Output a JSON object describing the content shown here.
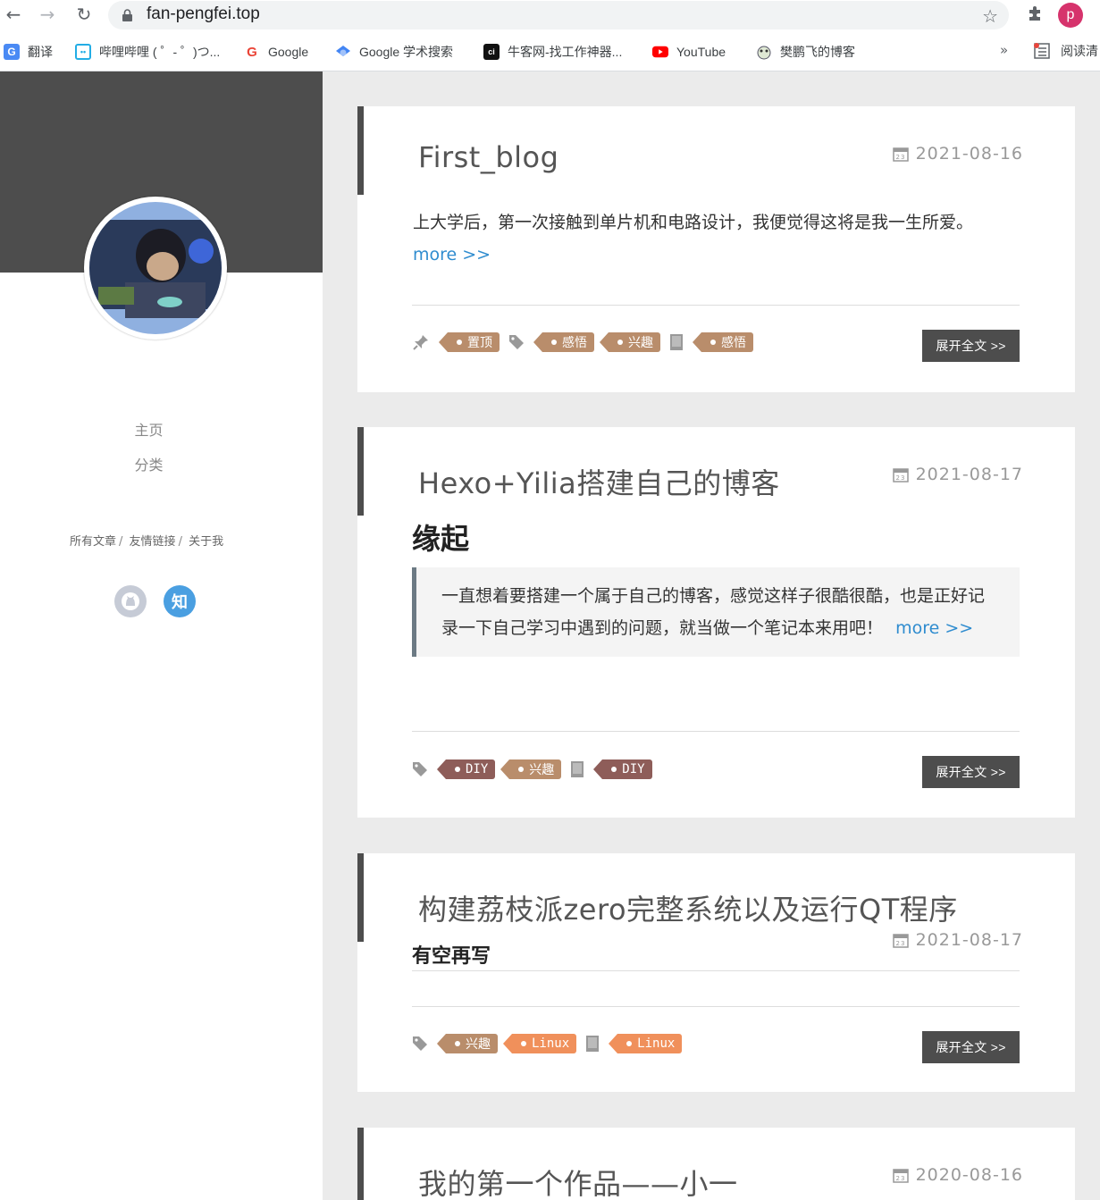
{
  "browser": {
    "url": "fan-pengfei.top",
    "profile_initial": "p",
    "bookmarks": [
      {
        "label": "翻译",
        "icon": "google-translate-icon"
      },
      {
        "label": "哔哩哔哩 ( ゜- ゜)つ...",
        "icon": "bilibili-icon"
      },
      {
        "label": "Google",
        "icon": "google-icon"
      },
      {
        "label": "Google 学术搜索",
        "icon": "google-scholar-icon"
      },
      {
        "label": "牛客网-找工作神器...",
        "icon": "nowcoder-icon"
      },
      {
        "label": "YouTube",
        "icon": "youtube-icon"
      },
      {
        "label": "樊鹏飞的博客",
        "icon": "blog-frog-icon"
      }
    ],
    "overflow_label": "»",
    "reading_list_label": "阅读清"
  },
  "sidebar": {
    "nav": [
      "主页",
      "分类"
    ],
    "links": [
      "所有文章",
      "友情链接",
      "关于我"
    ],
    "link_separator": "/",
    "social": [
      {
        "name": "github-icon",
        "color": "#c6cbd6"
      },
      {
        "name": "zhihu-icon",
        "label": "知",
        "color": "#4a9fe1"
      }
    ]
  },
  "posts": [
    {
      "title": "First_blog",
      "date": "2021-08-16",
      "excerpt": "上大学后，第一次接触到单片机和电路设计，我便觉得这将是我一生所爱。",
      "more": "more >>",
      "pinned_label": "置顶",
      "tags": [
        "感悟",
        "兴趣"
      ],
      "categories": [
        "感悟"
      ],
      "button": "展开全文 >>"
    },
    {
      "title": "Hexo+Yilia搭建自己的博客",
      "date": "2021-08-17",
      "subheading": "缘起",
      "quote": "一直想着要搭建一个属于自己的博客，感觉这样子很酷很酷，也是正好记录一下自己学习中遇到的问题，就当做一个笔记本来用吧！",
      "more": "more >>",
      "tags": [
        "DIY",
        "兴趣"
      ],
      "categories": [
        "DIY"
      ],
      "button": "展开全文 >>"
    },
    {
      "title": "构建荔枝派zero完整系统以及运行QT程序",
      "date": "2021-08-17",
      "subheading": "有空再写",
      "tags": [
        "兴趣",
        "Linux"
      ],
      "categories": [
        "Linux"
      ],
      "button": "展开全文 >>"
    },
    {
      "title": "我的第一个作品——小一",
      "date": "2020-08-16"
    }
  ],
  "colors": {
    "banner": "#4d4d4d",
    "tag_brown": "#b98d6b",
    "tag_maroon": "#8e5d59",
    "tag_orange": "#f0905b",
    "link_blue": "#2f8ccf",
    "button_dark": "#4d4d4d"
  }
}
